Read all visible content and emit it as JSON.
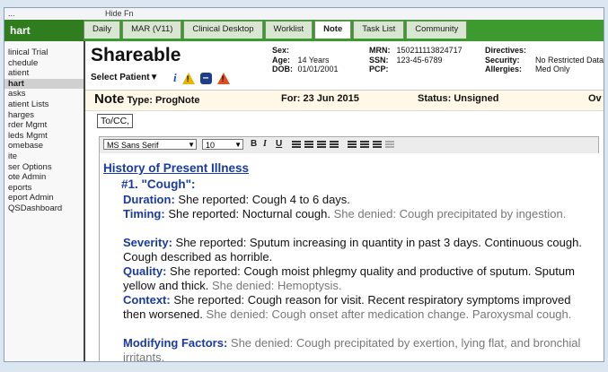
{
  "top_strip": {
    "left": "...",
    "right": "Hide Fn"
  },
  "sidebar": {
    "heading": "hart",
    "items": [
      {
        "label": "linical Trial",
        "selected": false
      },
      {
        "label": "chedule",
        "selected": false
      },
      {
        "label": "atient",
        "selected": false
      },
      {
        "label": "hart",
        "selected": true
      },
      {
        "label": "asks",
        "selected": false
      },
      {
        "label": "atient Lists",
        "selected": false
      },
      {
        "label": "harges",
        "selected": false
      },
      {
        "label": "rder Mgmt",
        "selected": false
      },
      {
        "label": "leds Mgmt",
        "selected": false
      },
      {
        "label": "omebase",
        "selected": false
      },
      {
        "label": "ite",
        "selected": false
      },
      {
        "label": "ser Options",
        "selected": false
      },
      {
        "label": "ote Admin",
        "selected": false
      },
      {
        "label": "eports",
        "selected": false
      },
      {
        "label": "eport Admin",
        "selected": false
      },
      {
        "label": "QSDashboard",
        "selected": false
      }
    ]
  },
  "tabs": [
    {
      "label": "Daily",
      "active": false
    },
    {
      "label": "MAR (V11)",
      "active": false
    },
    {
      "label": "Clinical Desktop",
      "active": false
    },
    {
      "label": "Worklist",
      "active": false
    },
    {
      "label": "Note",
      "active": true
    },
    {
      "label": "Task List",
      "active": false
    },
    {
      "label": "Community",
      "active": false
    }
  ],
  "banner": {
    "patient_name": "Shareable",
    "select_patient": "Select Patient▼",
    "sex_label": "Sex:",
    "sex_value": "",
    "age_label": "Age:",
    "age_value": "14 Years",
    "dob_label": "DOB:",
    "dob_value": "01/01/2001",
    "mrn_label": "MRN:",
    "mrn_value": "150211113824717",
    "ssn_label": "SSN:",
    "ssn_value": "123-45-6789",
    "pcp_label": "PCP:",
    "pcp_value": "",
    "directives_label": "Directives:",
    "directives_value": "",
    "security_label": "Security:",
    "security_value": "No Restricted Data",
    "allergies_label": "Allergies:",
    "allergies_value": "Med Only",
    "icons": [
      "info-icon",
      "warning-icon",
      "minimize-icon",
      "alert-icon"
    ]
  },
  "note_bar": {
    "note_label": "Note",
    "type_label": "Type:",
    "type_value": "ProgNote",
    "for_label": "For:",
    "for_value": "23 Jun 2015",
    "status_label": "Status:",
    "status_value": "Unsigned",
    "trailing": "Ov"
  },
  "tocc_button": "To/CC,",
  "toolbar": {
    "font": "MS Sans Serif",
    "size": "10",
    "bold": "B",
    "italic": "I",
    "underline": "U"
  },
  "editor": {
    "section_title": "History of Present Illness",
    "complaint": "#1. \"Cough\":",
    "duration_key": "Duration:",
    "duration_text": " She reported: Cough 4 to 6 days.",
    "timing_key": "Timing:",
    "timing_text": " She reported: Nocturnal cough.",
    "timing_neg": " She denied: Cough precipitated by ingestion.",
    "severity_key": "Severity:",
    "severity_text": " She reported: Sputum increasing in quantity in past 3 days. Continuous cough. Cough described as horrible.",
    "quality_key": "Quality:",
    "quality_text": " She reported: Cough moist phlegmy quality and productive of sputum. Sputum yellow and thick.",
    "quality_neg": " She denied: Hemoptysis.",
    "context_key": "Context:",
    "context_text": " She reported: Cough reason for visit. Recent respiratory symptoms improved then worsened.",
    "context_neg": " She denied: Cough onset after medication change. Paroxysmal cough.",
    "modifying_key": "Modifying Factors:",
    "modifying_neg": " She denied: Cough precipitated by exertion, lying flat, and bronchial irritants."
  },
  "colors": {
    "tab_bar_green": "#3d9a2e",
    "heading_blue": "#1a3aa0",
    "note_bar_bg": "#fff8e6"
  }
}
